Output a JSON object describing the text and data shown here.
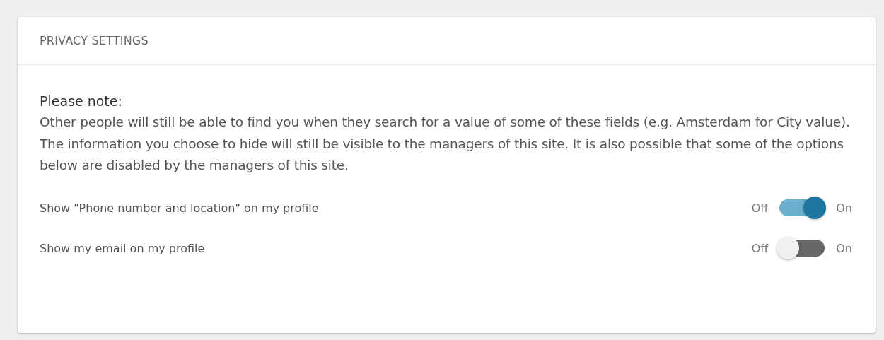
{
  "panel": {
    "title": "PRIVACY SETTINGS"
  },
  "note": {
    "heading": "Please note:",
    "text": "Other people will still be able to find you when they search for a value of some of these fields (e.g. Amsterdam for City value). The information you choose to hide will still be visible to the managers of this site. It is also possible that some of the options below are disabled by the managers of this site."
  },
  "settings": [
    {
      "label": "Show \"Phone number and location\" on my profile",
      "off_label": "Off",
      "on_label": "On",
      "on": true
    },
    {
      "label": "Show my email on my profile",
      "off_label": "Off",
      "on_label": "On",
      "on": false
    }
  ]
}
